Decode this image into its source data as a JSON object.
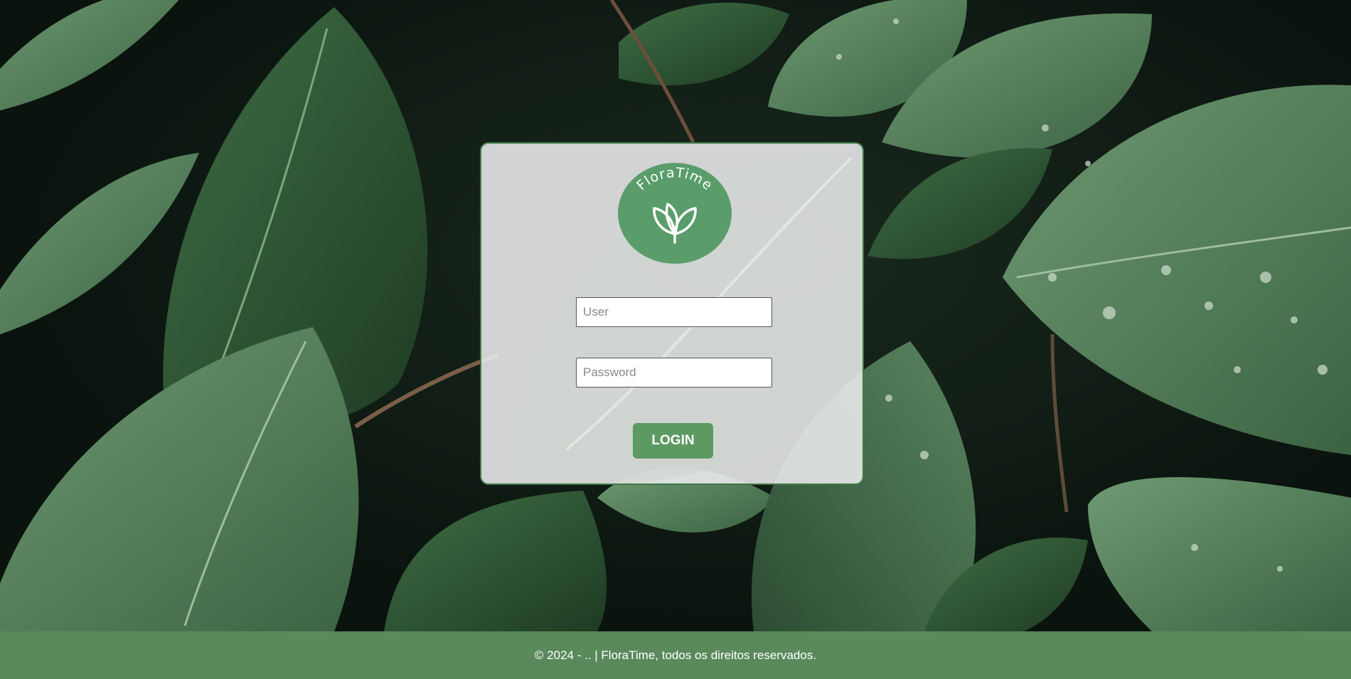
{
  "brand": {
    "name": "FloraTime",
    "logo_color": "#5a9d6a"
  },
  "login_form": {
    "user_placeholder": "User",
    "user_value": "",
    "password_placeholder": "Password",
    "password_value": "",
    "login_label": "LOGIN"
  },
  "footer": {
    "text": "© 2024 - .. | FloraTime, todos os direitos reservados."
  },
  "colors": {
    "accent": "#5c9a62",
    "footer_bg": "#5a8a5c",
    "card_border": "#3f7a48"
  },
  "icons": {
    "logo": "leaf-icon"
  }
}
